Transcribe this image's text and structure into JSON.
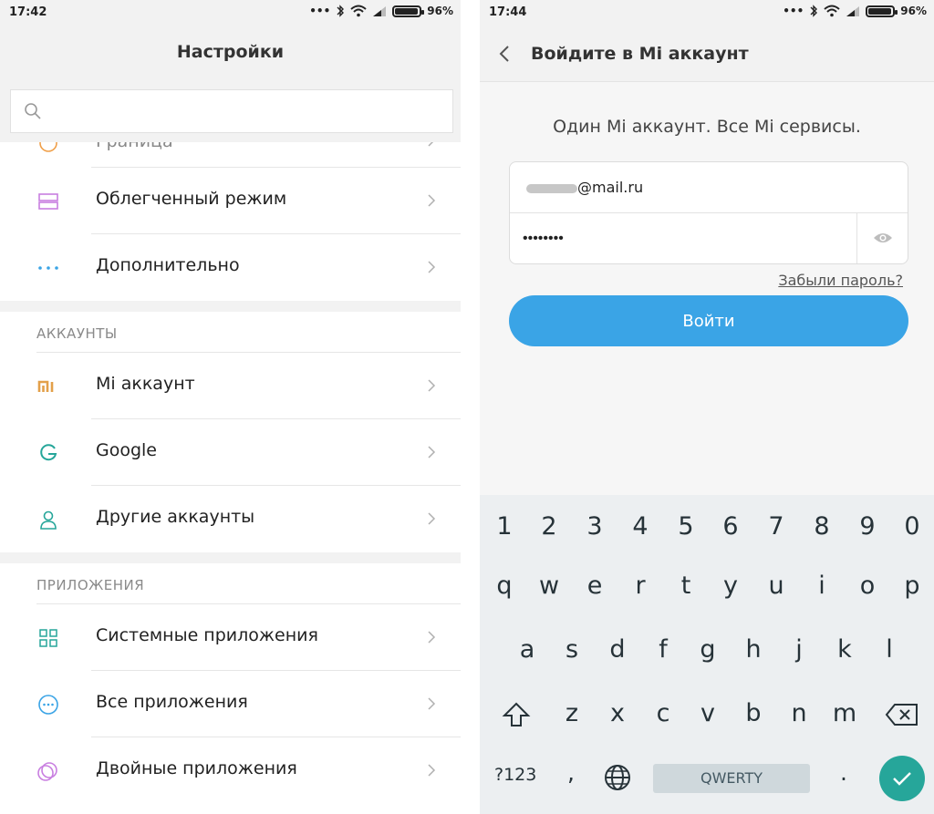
{
  "left": {
    "status": {
      "time": "17:42",
      "battery": "96%"
    },
    "title": "Настройки",
    "search": {
      "placeholder": ""
    },
    "partial_label": "Граница",
    "items_top": [
      {
        "label": "Облегченный режим",
        "icon": "lite-mode-icon"
      },
      {
        "label": "Дополнительно",
        "icon": "more-dots-icon"
      }
    ],
    "sections": [
      {
        "title": "АККАУНТЫ",
        "items": [
          {
            "label": "Mi аккаунт",
            "icon": "mi-logo-icon"
          },
          {
            "label": "Google",
            "icon": "google-icon"
          },
          {
            "label": "Другие аккаунты",
            "icon": "person-icon"
          }
        ]
      },
      {
        "title": "ПРИЛОЖЕНИЯ",
        "items": [
          {
            "label": "Системные приложения",
            "icon": "grid-icon"
          },
          {
            "label": "Все приложения",
            "icon": "apps-circle-icon"
          },
          {
            "label": "Двойные приложения",
            "icon": "dual-apps-icon"
          }
        ]
      }
    ]
  },
  "right": {
    "status": {
      "time": "17:44",
      "battery": "96%"
    },
    "title": "Войдите в Mi аккаунт",
    "tagline": "Один Mi аккаунт. Все Mi сервисы.",
    "email_suffix": "@mail.ru",
    "password_value": "••••••••",
    "forgot_label": "Забыли пароль?",
    "login_label": "Войти",
    "keyboard": {
      "numbers": [
        "1",
        "2",
        "3",
        "4",
        "5",
        "6",
        "7",
        "8",
        "9",
        "0"
      ],
      "row1": [
        "q",
        "w",
        "e",
        "r",
        "t",
        "y",
        "u",
        "i",
        "o",
        "p"
      ],
      "row2": [
        "a",
        "s",
        "d",
        "f",
        "g",
        "h",
        "j",
        "k",
        "l"
      ],
      "row3": [
        "z",
        "x",
        "c",
        "v",
        "b",
        "n",
        "m"
      ],
      "sym_label": "?123",
      "comma": ",",
      "space_label": "QWERTY",
      "period": "."
    }
  },
  "colors": {
    "accent": "#3aa4e6",
    "done": "#26a69a",
    "mi": "#e3a04a"
  }
}
